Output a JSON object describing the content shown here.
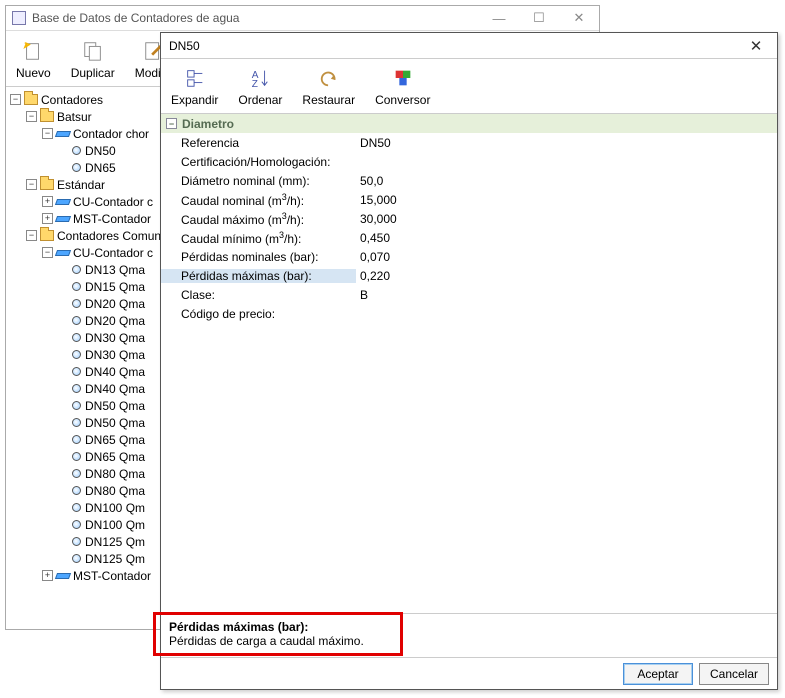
{
  "bg_window": {
    "title": "Base de Datos de Contadores de agua",
    "toolbar": {
      "nuevo": "Nuevo",
      "duplicar": "Duplicar",
      "modificar": "Modific"
    },
    "tree": {
      "root": "Contadores",
      "batsur": {
        "label": "Batsur",
        "sub": "Contador chor",
        "items": [
          "DN50",
          "DN65"
        ]
      },
      "estandar": {
        "label": "Estándar",
        "items": [
          "CU-Contador c",
          "MST-Contador"
        ]
      },
      "comunes": {
        "label": "Contadores Comun",
        "cu": {
          "label": "CU-Contador c",
          "items": [
            "DN13 Qma",
            "DN15 Qma",
            "DN20 Qma",
            "DN20 Qma",
            "DN30 Qma",
            "DN30 Qma",
            "DN40 Qma",
            "DN40 Qma",
            "DN50 Qma",
            "DN50 Qma",
            "DN65 Qma",
            "DN65 Qma",
            "DN80 Qma",
            "DN80 Qma",
            "DN100 Qm",
            "DN100 Qm",
            " DN125 Qm",
            "DN125 Qm"
          ]
        },
        "mst": "MST-Contador"
      }
    }
  },
  "dialog": {
    "title": "DN50",
    "toolbar": {
      "expandir": "Expandir",
      "ordenar": "Ordenar",
      "restaurar": "Restaurar",
      "conversor": "Conversor"
    },
    "section": "Diametro",
    "props": [
      {
        "lbl": "Referencia",
        "val": "DN50"
      },
      {
        "lbl": "Certificación/Homologación:",
        "val": ""
      },
      {
        "lbl": "Diámetro nominal (mm):",
        "val": "50,0"
      },
      {
        "lbl_html": "Caudal nominal (m<sup>3</sup>/h):",
        "val": "15,000"
      },
      {
        "lbl_html": "Caudal máximo (m<sup>3</sup>/h):",
        "val": "30,000"
      },
      {
        "lbl_html": "Caudal mínimo (m<sup>3</sup>/h):",
        "val": "0,450"
      },
      {
        "lbl": "Pérdidas nominales (bar):",
        "val": "0,070"
      },
      {
        "lbl": "Pérdidas máximas (bar):",
        "val": "0,220",
        "selected": true
      },
      {
        "lbl": "Clase:",
        "val": "B"
      },
      {
        "lbl": "Código de precio:",
        "val": ""
      }
    ],
    "footer": {
      "heading": "Pérdidas máximas (bar):",
      "text": "Pérdidas de carga a caudal máximo."
    },
    "buttons": {
      "ok": "Aceptar",
      "cancel": "Cancelar"
    }
  }
}
